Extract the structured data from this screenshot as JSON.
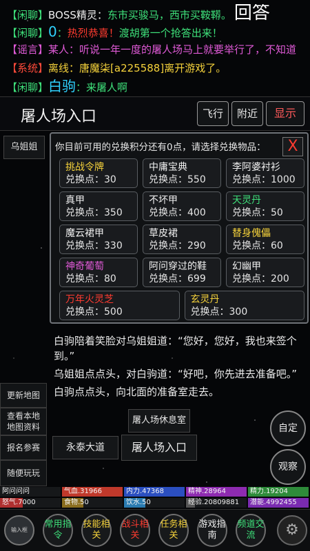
{
  "chat": [
    {
      "tag": "【闲聊】",
      "speaker": "BOSS精灵：",
      "text": "东市买骏马，西市买鞍鞯。",
      "extra": "回答"
    },
    {
      "tag": "【闲聊】",
      "speaker": "0",
      "sep": "：",
      "text": "热烈恭喜！",
      "tail": "渡胡第一个抢答出来！"
    },
    {
      "tag": "【谣言】",
      "speaker": "某人：",
      "text": "听说一年一度的屠人场马上就要举行了，不知道"
    },
    {
      "tag": "【系统】",
      "speaker": "离线：",
      "text": "唐魔柒[a225588]离开游戏了。"
    },
    {
      "tag": "【闲聊】",
      "speaker": "白驹",
      "sep": "：",
      "text": "来屠人啊"
    }
  ],
  "location": {
    "title": "屠人场入口",
    "fly_label": "飞行",
    "nearby_label": "附近",
    "show_label": "显示"
  },
  "left_panel": {
    "npc_label": "乌姐姐",
    "refresh_map": "更新地图",
    "view_map": "查看本地地图资料",
    "signup": "报名参赛",
    "play": "随便玩玩"
  },
  "dialog": {
    "header": "你目前可用的兑换积分还有0点，请选择兑换物品：",
    "close": "X",
    "items": [
      {
        "name": "挑战令牌",
        "cost": "兑换点：30",
        "color": "#f5d23b"
      },
      {
        "name": "中庸宝典",
        "cost": "兑换点：550",
        "color": "#f0f0f0"
      },
      {
        "name": "李阿婆衬衫",
        "cost": "兑换点：1000",
        "color": "#f0f0f0"
      },
      {
        "name": "真甲",
        "cost": "兑换点：350",
        "color": "#f0f0f0"
      },
      {
        "name": "不坏甲",
        "cost": "兑换点：400",
        "color": "#f0f0f0"
      },
      {
        "name": "天灵丹",
        "cost": "兑换点：50",
        "color": "#3ee07a"
      },
      {
        "name": "魔云裙甲",
        "cost": "兑换点：330",
        "color": "#f0f0f0"
      },
      {
        "name": "草皮裙",
        "cost": "兑换点：290",
        "color": "#f0f0f0"
      },
      {
        "name": "替身傀儡",
        "cost": "兑换点：60",
        "color": "#f5d23b"
      },
      {
        "name": "神奇葡萄",
        "cost": "兑换点：80",
        "color": "#e05ad7"
      },
      {
        "name": "阿问穿过的鞋",
        "cost": "兑换点：699",
        "color": "#f0f0f0"
      },
      {
        "name": "幻幽甲",
        "cost": "兑换点：200",
        "color": "#f0f0f0"
      },
      {
        "name": "万年火灵芝",
        "cost": "兑换点：500",
        "color": "#ff3b30"
      },
      {
        "name": "玄灵丹",
        "cost": "兑换点：300",
        "color": "#f5d23b"
      }
    ]
  },
  "narration": [
    "白驹陪着笑脸对乌姐姐道：“您好，您好，我也来签个到。”",
    "乌姐姐点点头，对白驹道：“好吧，你先进去准备吧。”",
    "白驹点点头，向北面的准备室走去。"
  ],
  "exits": {
    "north": "屠人场休息室",
    "west": "永泰大道",
    "current": "屠人场入口"
  },
  "round_buttons": {
    "custom": "自定",
    "watch": "观察"
  },
  "stats": [
    {
      "label": "阿问问问",
      "color": "#1a1a1a",
      "fill": 0
    },
    {
      "label": "气血.31966",
      "color": "#c0392b",
      "fill": 1
    },
    {
      "label": "内力.47368",
      "color": "#2b4fc0",
      "fill": 1
    },
    {
      "label": "精神.28964",
      "color": "#8e2bb0",
      "fill": 1
    },
    {
      "label": "精力.19204",
      "color": "#2e8b3a",
      "fill": 1
    },
    {
      "label": "怒气.7000",
      "color": "#b03030",
      "fill": 0.38
    },
    {
      "label": "食物.50",
      "color": "#8a6d1f",
      "fill": 0.35
    },
    {
      "label": "饮水.50",
      "color": "#2a7bb0",
      "fill": 0.35
    },
    {
      "label": "经验.20809881",
      "color": "#555555",
      "fill": 0.15
    },
    {
      "label": "潜能.4992455",
      "color": "#7a2bb0",
      "fill": 1
    }
  ],
  "nav": {
    "avatar": "输入框",
    "common": "常用指令",
    "skills": "技能相关",
    "combat": "战斗相关",
    "quest": "任务相关",
    "guide": "游戏指南",
    "chat": "频道交流",
    "settings_icon": "gear-icon"
  }
}
